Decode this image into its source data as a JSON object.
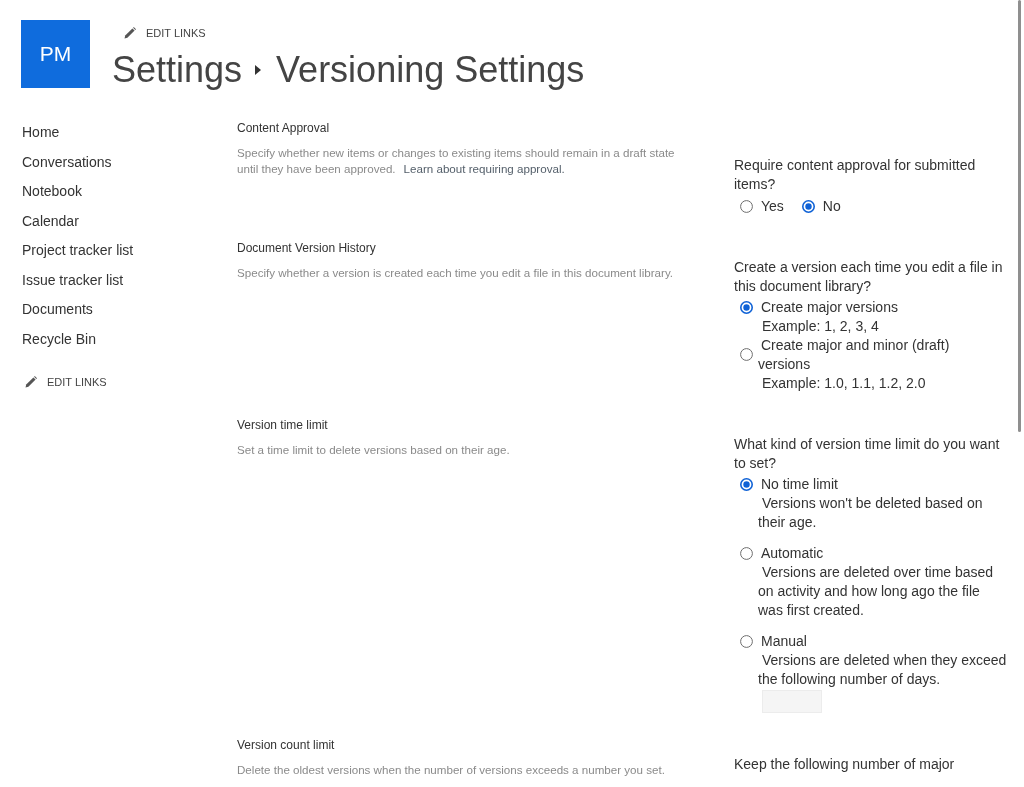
{
  "header": {
    "logo_text": "PM",
    "edit_links": "EDIT LINKS",
    "breadcrumb": [
      "Settings",
      "Versioning Settings"
    ]
  },
  "nav": {
    "items": [
      "Home",
      "Conversations",
      "Notebook",
      "Calendar",
      "Project tracker list",
      "Issue tracker list",
      "Documents",
      "Recycle Bin"
    ],
    "edit_links": "EDIT LINKS"
  },
  "sections": [
    {
      "title": "Content Approval",
      "description": "Specify whether new items or changes to existing items should remain in a draft state until they have been approved.",
      "link": "Learn about requiring approval.",
      "question": "Require content approval for submitted items?",
      "kind": "inline",
      "options": [
        {
          "label": "Yes",
          "selected": false
        },
        {
          "label": "No",
          "selected": true
        }
      ]
    },
    {
      "title": "Document Version History",
      "description": "Specify whether a version is created each time you edit a file in this document library.",
      "question": "Create a version each time you edit a file in this document library?",
      "kind": "stacked",
      "options": [
        {
          "label": "Create major versions",
          "example": "Example: 1, 2, 3, 4",
          "selected": true
        },
        {
          "label": "Create major and minor (draft) versions",
          "example": "Example: 1.0, 1.1, 1.2, 2.0",
          "selected": false
        }
      ]
    },
    {
      "title": "Version time limit",
      "description": "Set a time limit to delete versions based on their age.",
      "question": "What kind of version time limit do you want to set?",
      "kind": "stacked",
      "options": [
        {
          "label": "No time limit",
          "description": "Versions won't be deleted based on their age.",
          "selected": true
        },
        {
          "label": "Automatic",
          "description": "Versions are deleted over time based on activity and how long ago the file was first created.",
          "selected": false
        },
        {
          "label": "Manual",
          "description": "Versions are deleted when they exceed the following number of days.",
          "selected": false,
          "field": {
            "disabled": true
          }
        }
      ]
    },
    {
      "title": "Version count limit",
      "description": "Delete the oldest versions when the number of versions exceeds a number you set.",
      "question": "Keep the following number of major"
    }
  ]
}
